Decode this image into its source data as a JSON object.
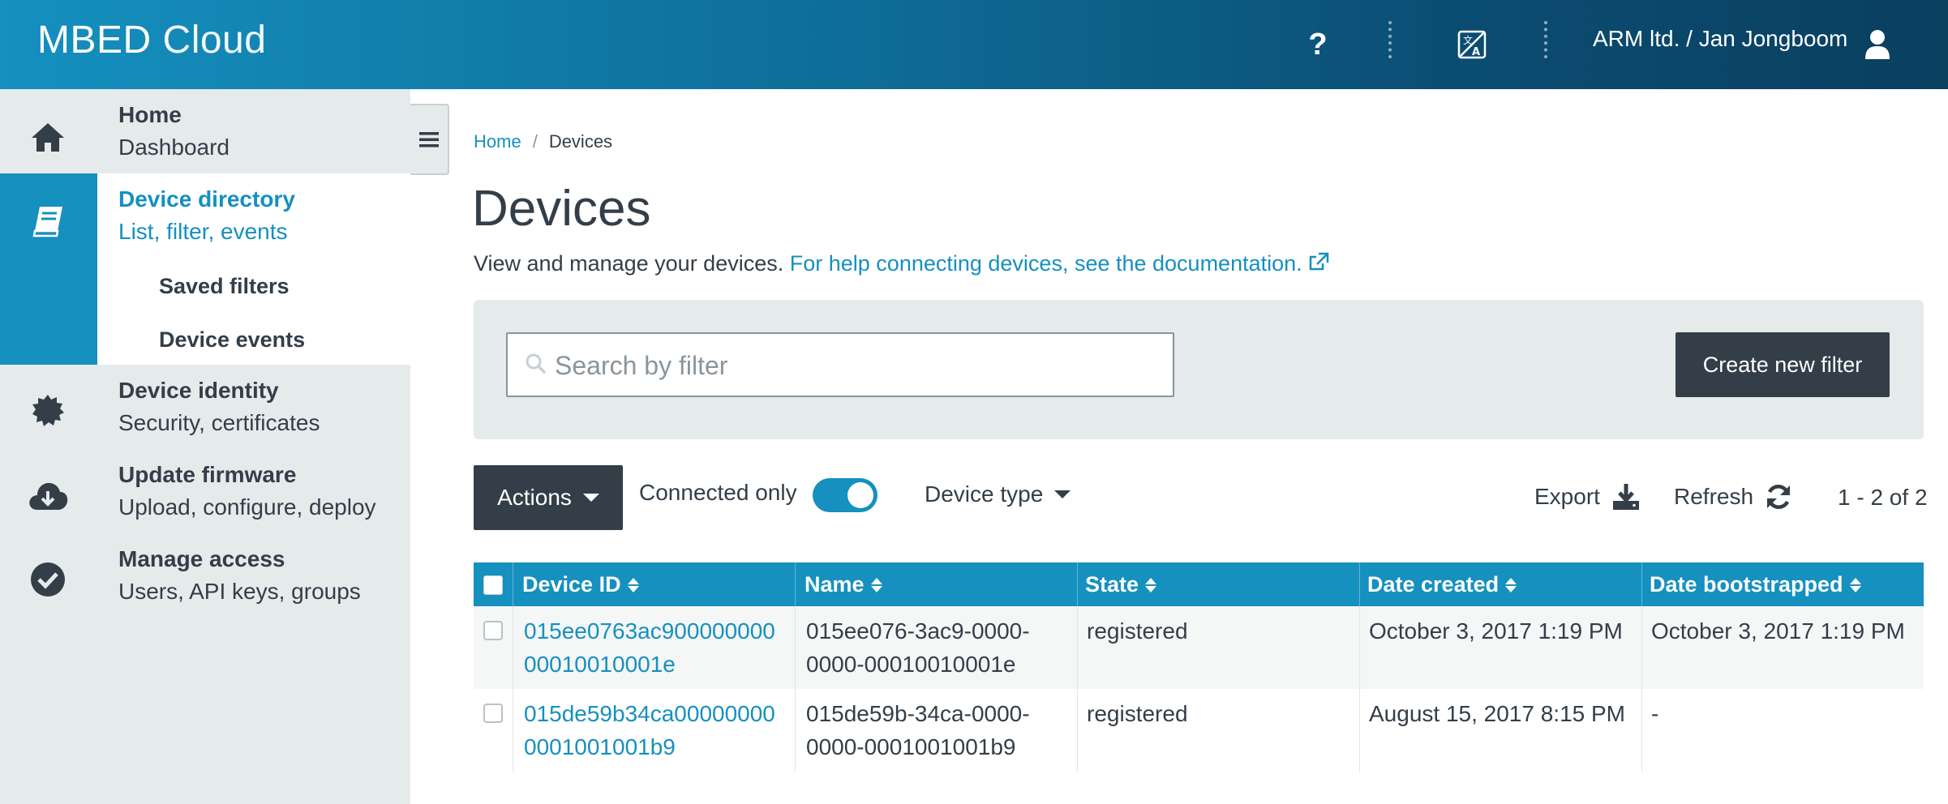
{
  "header": {
    "logo_bold": "MBED",
    "logo_light": "Cloud",
    "help_icon": "question-icon",
    "translate_icon": "translate-icon",
    "account_name": "ARM ltd. / Jan Jongboom",
    "user_icon": "user-icon"
  },
  "sidebar": {
    "items": [
      {
        "title": "Home",
        "subtitle": "Dashboard",
        "icon": "home-icon"
      },
      {
        "title": "Device directory",
        "subtitle": "List, filter, events",
        "icon": "book-icon",
        "active": true,
        "children": [
          {
            "label": "Saved filters"
          },
          {
            "label": "Device events"
          }
        ]
      },
      {
        "title": "Device identity",
        "subtitle": "Security, certificates",
        "icon": "badge-icon"
      },
      {
        "title": "Update firmware",
        "subtitle": "Upload, configure, deploy",
        "icon": "cloud-download-icon"
      },
      {
        "title": "Manage access",
        "subtitle": "Users, API keys, groups",
        "icon": "check-circle-icon"
      }
    ]
  },
  "breadcrumb": {
    "home": "Home",
    "separator": "/",
    "current": "Devices"
  },
  "page": {
    "title": "Devices",
    "description": "View and manage your devices.",
    "doc_link": "For help connecting devices, see the documentation."
  },
  "filter": {
    "search_placeholder": "Search by filter",
    "search_value": "",
    "create_button": "Create new filter"
  },
  "toolbar": {
    "actions_label": "Actions",
    "connected_only_label": "Connected only",
    "connected_only_on": true,
    "device_type_label": "Device type",
    "export_label": "Export",
    "refresh_label": "Refresh",
    "pagination": "1 - 2 of 2"
  },
  "table": {
    "columns": [
      "Device ID",
      "Name",
      "State",
      "Date created",
      "Date bootstrapped"
    ],
    "rows": [
      {
        "device_id_line1": "015ee0763ac900000000",
        "device_id_line2": "00010010001e",
        "name_line1": "015ee076-3ac9-0000-",
        "name_line2": "0000-00010010001e",
        "state": "registered",
        "date_created": "October 3, 2017 1:19 PM",
        "date_bootstrapped": "October 3, 2017 1:19 PM"
      },
      {
        "device_id_line1": "015de59b34ca00000000",
        "device_id_line2": "0001001001b9",
        "name_line1": "015de59b-34ca-0000-",
        "name_line2": "0000-0001001001b9",
        "state": "registered",
        "date_created": "August 15, 2017 8:15 PM",
        "date_bootstrapped": "-"
      }
    ]
  },
  "colors": {
    "accent": "#1590bf",
    "dark": "#333e48",
    "sidebar_bg": "#e5eaeb",
    "header_dark": "#0a3f60"
  }
}
